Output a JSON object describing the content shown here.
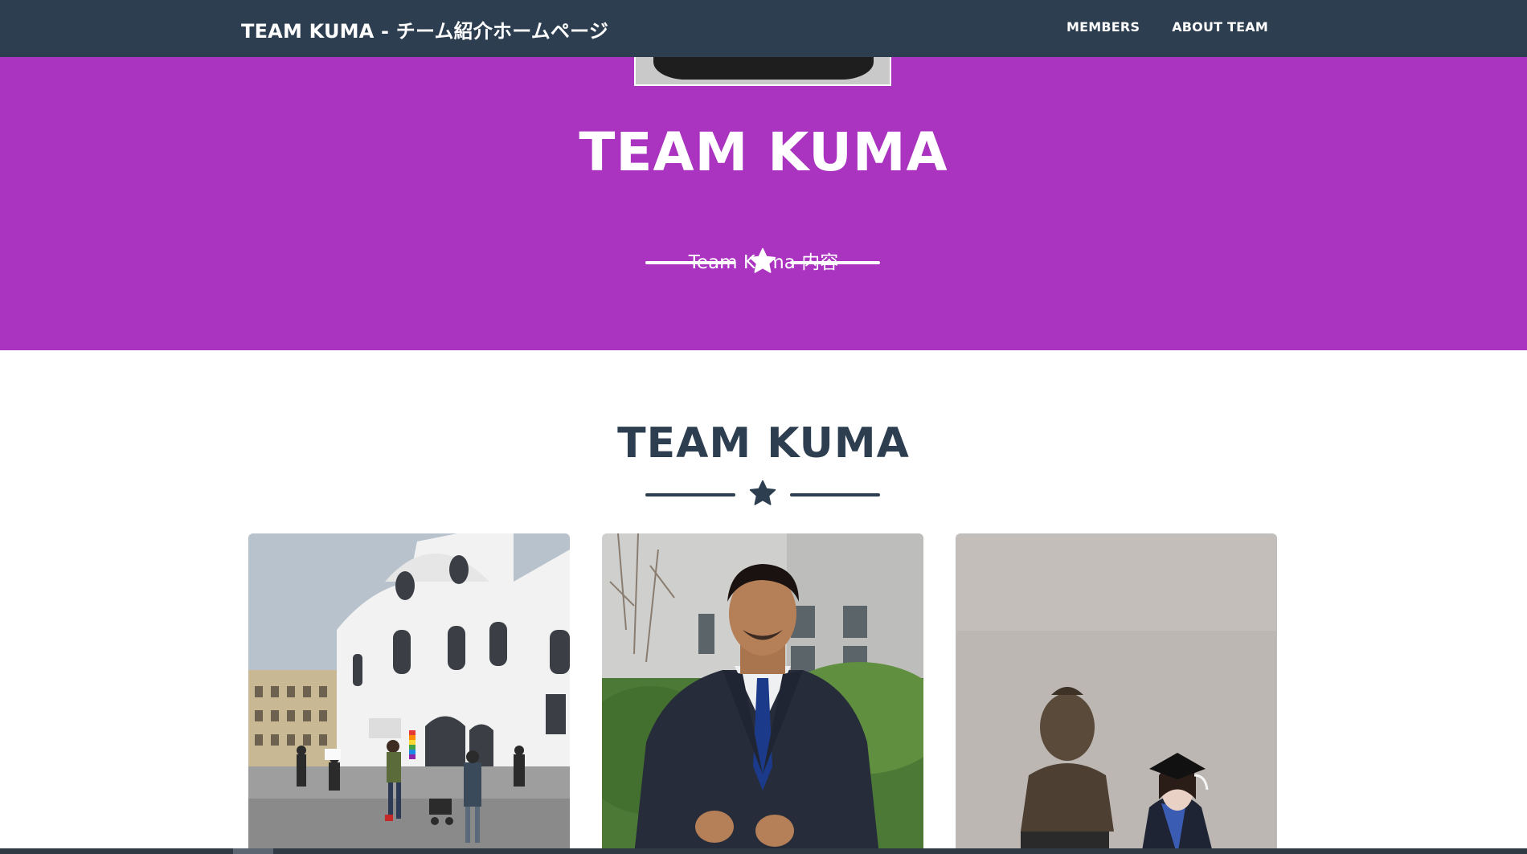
{
  "navbar": {
    "brand": "TEAM KUMA - チーム紹介ホームページ",
    "links": [
      "MEMBERS",
      "ABOUT TEAM"
    ]
  },
  "hero": {
    "title": "TEAM KUMA",
    "subtitle": "Team Kuma 内容"
  },
  "section": {
    "title": "TEAM KUMA"
  },
  "colors": {
    "nav": "#2c3e50",
    "hero": "#aa33c0",
    "text_dark": "#2c3e50"
  },
  "icons": [
    "star-icon"
  ]
}
